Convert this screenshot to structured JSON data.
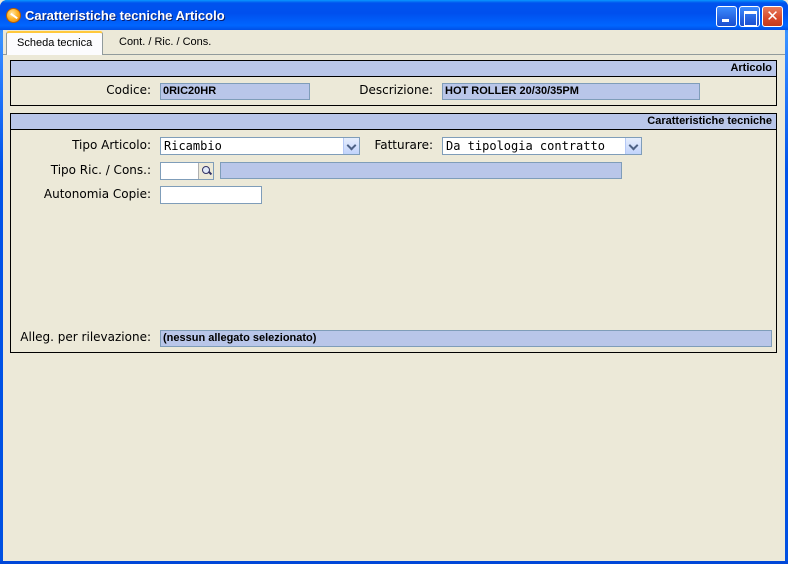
{
  "window": {
    "title": "Caratteristiche tecniche Articolo"
  },
  "tabs": [
    {
      "label": "Scheda tecnica",
      "active": true
    },
    {
      "label": "Cont. / Ric. / Cons.",
      "active": false
    }
  ],
  "articolo": {
    "header": "Articolo",
    "codice_label": "Codice:",
    "codice_value": "0RIC20HR",
    "descrizione_label": "Descrizione:",
    "descrizione_value": "HOT ROLLER 20/30/35PM"
  },
  "caratteristiche": {
    "header": "Caratteristiche tecniche",
    "tipo_articolo_label": "Tipo Articolo:",
    "tipo_articolo_value": "Ricambio",
    "fatturare_label": "Fatturare:",
    "fatturare_value": "Da tipologia contratto",
    "tipo_ric_label": "Tipo Ric. / Cons.:",
    "tipo_ric_code": "",
    "tipo_ric_desc": "",
    "autonomia_label": "Autonomia Copie:",
    "autonomia_value": "",
    "alleg_label": "Alleg. per rilevazione:",
    "alleg_value": "(nessun allegato selezionato)"
  },
  "colors": {
    "titlebar": "#0053ee",
    "panel_header": "#b9c6e9",
    "readonly_field": "#b9c6e9",
    "window_bg": "#ece9d8",
    "tab_accent": "#ffc83c"
  },
  "icons": {
    "app": "app-icon",
    "minimize": "minimize-icon",
    "maximize": "maximize-icon",
    "close": "close-icon",
    "lookup": "magnifier-icon"
  }
}
